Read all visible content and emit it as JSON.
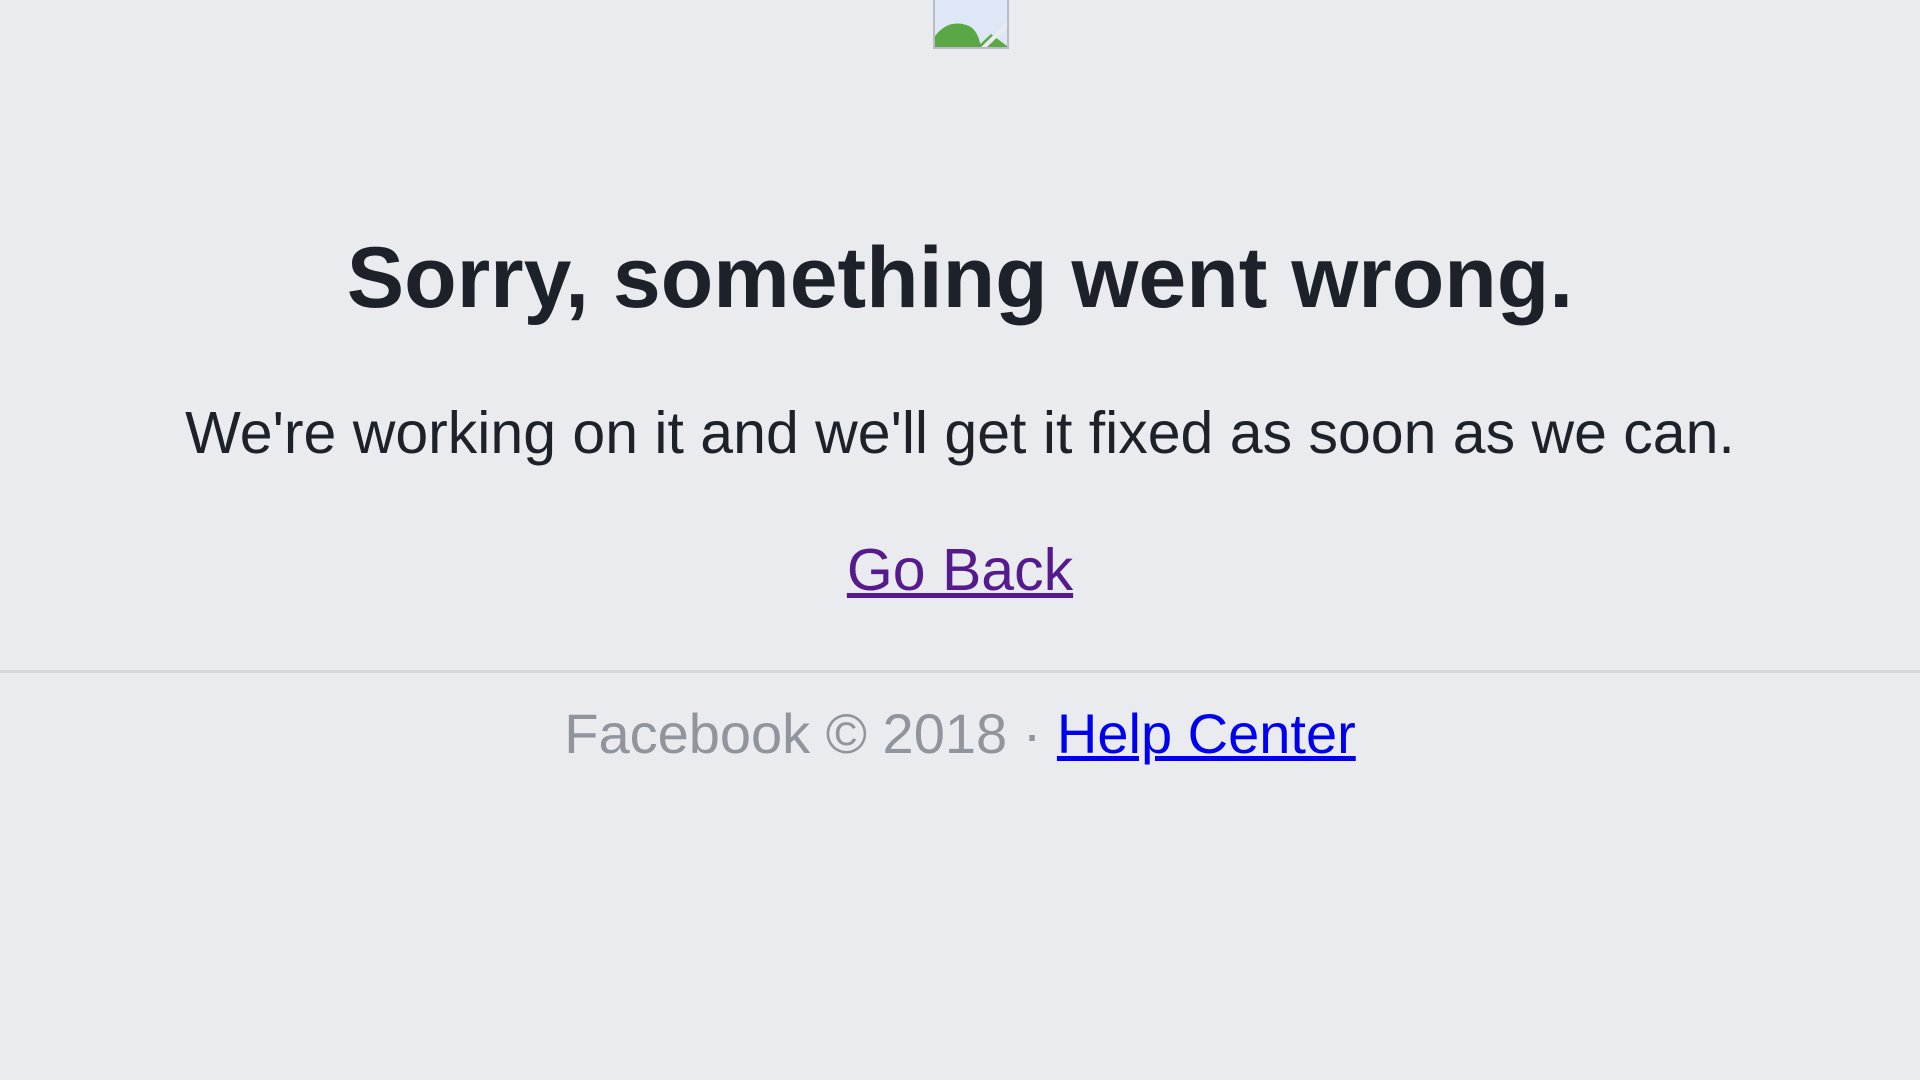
{
  "error_page": {
    "title": "Sorry, something went wrong.",
    "message": "We're working on it and we'll get it fixed as soon as we can.",
    "go_back_label": "Go Back"
  },
  "footer": {
    "copyright": "Facebook © 2018",
    "separator": "·",
    "help_center_label": "Help Center"
  },
  "colors": {
    "background": "#e9ebee",
    "text": "#1d2129",
    "visited_link": "#551a8b",
    "link": "#0000ee",
    "footer_text": "#90949c"
  },
  "icons": {
    "logo_placeholder": "broken-image-icon"
  }
}
